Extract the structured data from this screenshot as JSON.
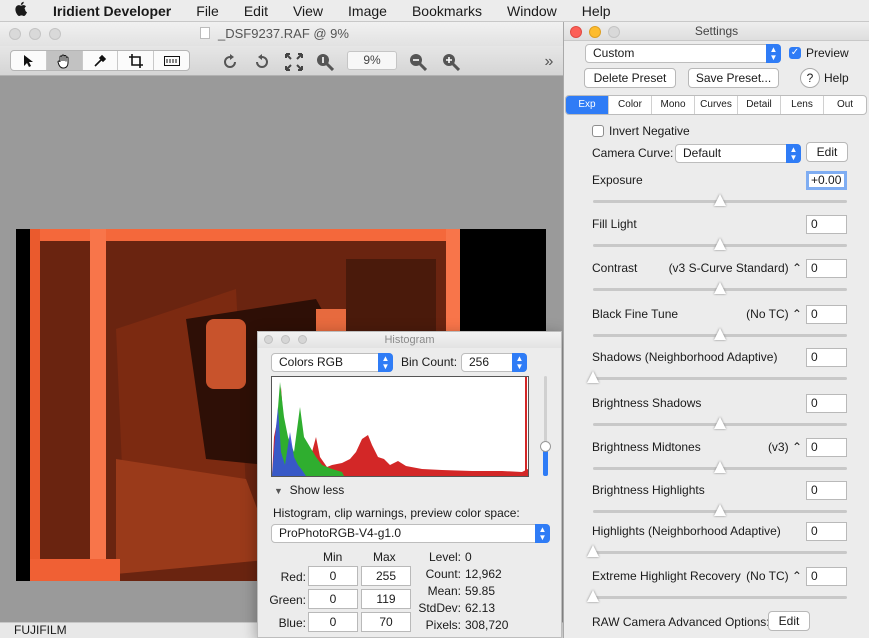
{
  "menubar": {
    "app": "Iridient Developer",
    "items": [
      "File",
      "Edit",
      "View",
      "Image",
      "Bookmarks",
      "Window",
      "Help"
    ]
  },
  "main": {
    "title": "_DSF9237.RAF @  9%",
    "zoom": "9%",
    "status": "FUJIFILM"
  },
  "histogram": {
    "title": "Histogram",
    "mode": "Colors RGB",
    "bin_label": "Bin Count:",
    "bin_value": "256",
    "toggle": "Show less",
    "desc": "Histogram, clip warnings, preview color space:",
    "space": "ProPhotoRGB-V4-g1.0",
    "col_min": "Min",
    "col_max": "Max",
    "red_label": "Red:",
    "red_min": "0",
    "red_max": "255",
    "green_label": "Green:",
    "green_min": "0",
    "green_max": "119",
    "blue_label": "Blue:",
    "blue_min": "0",
    "blue_max": "70",
    "stats": [
      {
        "label": "Level:",
        "value": "0"
      },
      {
        "label": "Count:",
        "value": "12,962"
      },
      {
        "label": "Mean:",
        "value": "59.85"
      },
      {
        "label": "StdDev:",
        "value": "62.13"
      },
      {
        "label": "Pixels:",
        "value": "308,720"
      }
    ]
  },
  "settings": {
    "title": "Settings",
    "preset": "Custom",
    "preview_label": "Preview",
    "preview_checked": true,
    "delete_preset": "Delete Preset",
    "save_preset": "Save Preset...",
    "help": "Help",
    "tabs": [
      "Exp",
      "Color",
      "Mono",
      "Curves",
      "Detail",
      "Lens",
      "Out"
    ],
    "active_tab": "Exp",
    "invert_label": "Invert Negative",
    "camera_curve_label": "Camera Curve:",
    "camera_curve_value": "Default",
    "edit_label": "Edit",
    "rows": [
      {
        "label": "Exposure",
        "mode": "",
        "value": "+0.00",
        "slider_pos": 0.5
      },
      {
        "label": "Fill Light",
        "mode": "",
        "value": "0",
        "slider_pos": 0.5
      },
      {
        "label": "Contrast",
        "mode": "(v3 S-Curve Standard) ⌃",
        "value": "0",
        "slider_pos": 0.5
      },
      {
        "label": "Black Fine Tune",
        "mode": "(No TC) ⌃",
        "value": "0",
        "slider_pos": 0.5
      },
      {
        "label": "Shadows (Neighborhood Adaptive)",
        "mode": "",
        "value": "0",
        "slider_pos": 0.0
      },
      {
        "label": "Brightness Shadows",
        "mode": "",
        "value": "0",
        "slider_pos": 0.5
      },
      {
        "label": "Brightness Midtones",
        "mode": "(v3) ⌃",
        "value": "0",
        "slider_pos": 0.5
      },
      {
        "label": "Brightness Highlights",
        "mode": "",
        "value": "0",
        "slider_pos": 0.5
      },
      {
        "label": "Highlights (Neighborhood Adaptive)",
        "mode": "",
        "value": "0",
        "slider_pos": 0.0
      },
      {
        "label": "Extreme Highlight Recovery",
        "mode": "(No TC) ⌃",
        "value": "0",
        "slider_pos": 0.0
      }
    ],
    "raw_label": "RAW Camera Advanced Options:",
    "raw_edit": "Edit"
  }
}
